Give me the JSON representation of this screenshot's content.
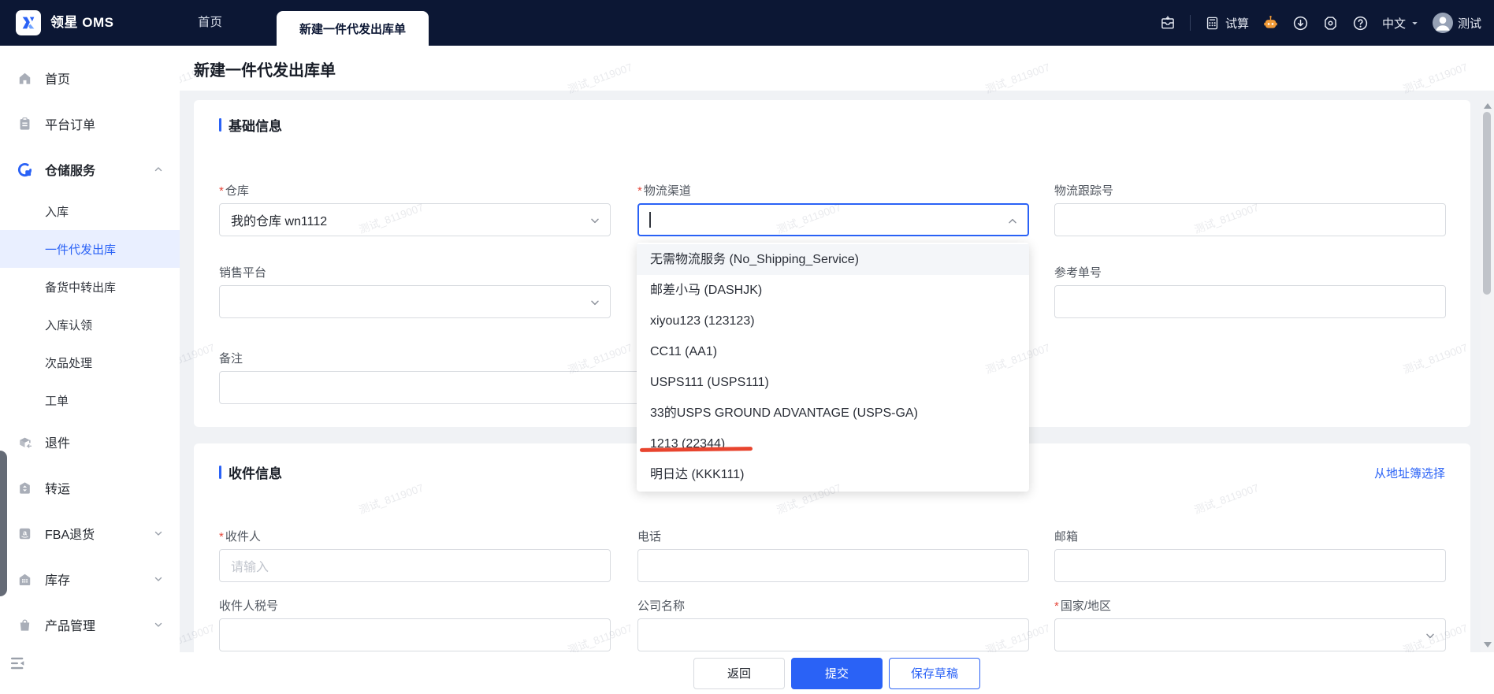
{
  "colors": {
    "accent": "#2a62f6",
    "navbar_bg": "#0c1734",
    "content_bg": "#f0f2f5",
    "active_item_bg": "#e9efff",
    "robot_orange": "#f09a37",
    "red_annotation": "#e8442e"
  },
  "navbar": {
    "logo_text": "领星 OMS",
    "tabs": [
      {
        "label": "首页",
        "active": false
      },
      {
        "label": "新建一件代发出库单",
        "active": true
      }
    ],
    "trial_label": "试算",
    "language_label": "中文",
    "username": "测试"
  },
  "sidebar": {
    "items": [
      {
        "label": "首页",
        "icon": "home-icon",
        "level": 1
      },
      {
        "label": "平台订单",
        "icon": "platform-orders-icon",
        "level": 1
      },
      {
        "label": "仓储服务",
        "icon": "warehouse-service-icon",
        "level": 1,
        "bold": true,
        "chevron": "up",
        "icon_accent": true
      },
      {
        "label": "入库",
        "level": 2
      },
      {
        "label": "一件代发出库",
        "level": 2,
        "active": true
      },
      {
        "label": "备货中转出库",
        "level": 2
      },
      {
        "label": "入库认领",
        "level": 2
      },
      {
        "label": "次品处理",
        "level": 2
      },
      {
        "label": "工单",
        "level": 2
      },
      {
        "label": "退件",
        "icon": "returns-icon",
        "level": 1
      },
      {
        "label": "转运",
        "icon": "transfer-icon",
        "level": 1
      },
      {
        "label": "FBA退货",
        "icon": "fba-icon",
        "level": 1,
        "chevron": "down"
      },
      {
        "label": "库存",
        "icon": "inventory-icon",
        "level": 1,
        "chevron": "down"
      },
      {
        "label": "产品管理",
        "icon": "products-icon",
        "level": 1,
        "chevron": "down"
      }
    ]
  },
  "page": {
    "title": "新建一件代发出库单",
    "watermark_text": "测试_8119007"
  },
  "basic_info": {
    "section_title": "基础信息",
    "warehouse": {
      "label": "仓库",
      "required": true,
      "value": "我的仓库 wn1112"
    },
    "logistics_channel": {
      "label": "物流渠道",
      "required": true,
      "value": ""
    },
    "tracking_no": {
      "label": "物流跟踪号",
      "value": ""
    },
    "sales_platform": {
      "label": "销售平台",
      "value": ""
    },
    "reference_no": {
      "label": "参考单号",
      "value": ""
    },
    "remark": {
      "label": "备注",
      "value": ""
    }
  },
  "channel_dropdown": {
    "options": [
      {
        "text": "无需物流服务 (No_Shipping_Service)",
        "highlighted": true
      },
      {
        "text": "邮差小马 (DASHJK)"
      },
      {
        "text": "xiyou123 (123123)"
      },
      {
        "text": "CC11 (AA1)"
      },
      {
        "text": "USPS111 (USPS111)"
      },
      {
        "text": "33的USPS GROUND ADVANTAGE (USPS-GA)"
      },
      {
        "text": "1213 (22344)",
        "red_underline": true
      },
      {
        "text": "明日达 (KKK111)"
      }
    ]
  },
  "recipient_info": {
    "section_title": "收件信息",
    "address_book_link": "从地址簿选择",
    "recipient": {
      "label": "收件人",
      "required": true,
      "placeholder": "请输入"
    },
    "phone": {
      "label": "电话",
      "value": ""
    },
    "email": {
      "label": "邮箱",
      "value": ""
    },
    "tax_no": {
      "label": "收件人税号",
      "value": ""
    },
    "company": {
      "label": "公司名称",
      "value": ""
    },
    "country": {
      "label": "国家/地区",
      "required": true,
      "value": ""
    }
  },
  "footer": {
    "back_label": "返回",
    "submit_label": "提交",
    "save_draft_label": "保存草稿"
  }
}
